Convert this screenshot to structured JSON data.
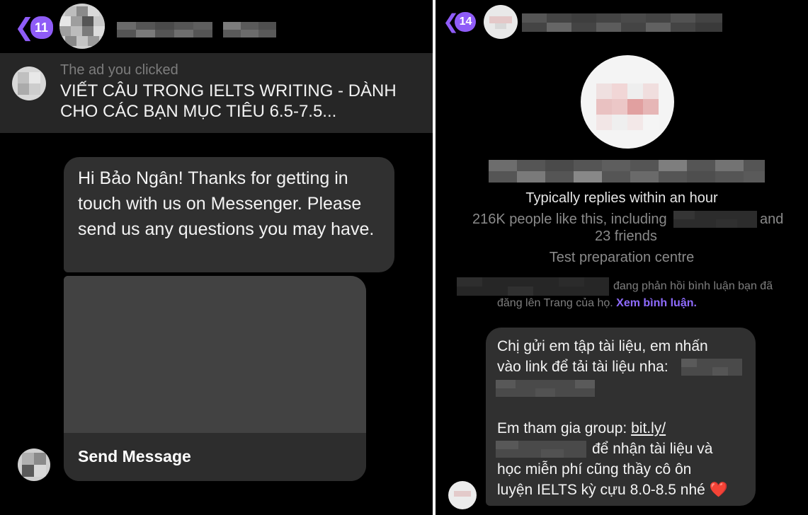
{
  "left": {
    "header": {
      "back_count": "11"
    },
    "ad": {
      "caption": "The ad you clicked",
      "title": "VIẾT CÂU TRONG IELTS WRITING - DÀNH CHO CÁC BẠN MỤC TIÊU 6.5-7.5..."
    },
    "greeting": "Hi Bảo Ngân! Thanks for getting in touch with us on Messenger. Please send us any questions you may have.",
    "card": {
      "button_label": "Send Message"
    }
  },
  "right": {
    "header": {
      "back_count": "14"
    },
    "page_info": {
      "reply_time": "Typically replies within an hour",
      "likes_prefix": "216K people like this, including",
      "likes_and": "and",
      "likes_friends": "23 friends",
      "category": "Test preparation centre"
    },
    "notice": {
      "text_1": "đang phản hồi bình luận bạn đã",
      "text_2": "đăng lên Trang của họ.",
      "link": "Xem bình luận."
    },
    "message": {
      "line_1": "Chị gửi em tập tài liệu, em nhấn",
      "line_2": "vào link để tải tài liệu nha:",
      "line_4a": "Em tham gia group:",
      "line_4b": "bit.ly/",
      "line_5": "để nhận tài liệu và",
      "line_6": "học miễn phí cũng thầy cô ôn",
      "line_7": "luyện IELTS kỳ cựu 8.0-8.5 nhé",
      "heart": "❤️"
    }
  },
  "colors": {
    "accent": "#8f5cf7",
    "link": "#8f6bff",
    "bubble": "#303030",
    "background": "#000000"
  }
}
